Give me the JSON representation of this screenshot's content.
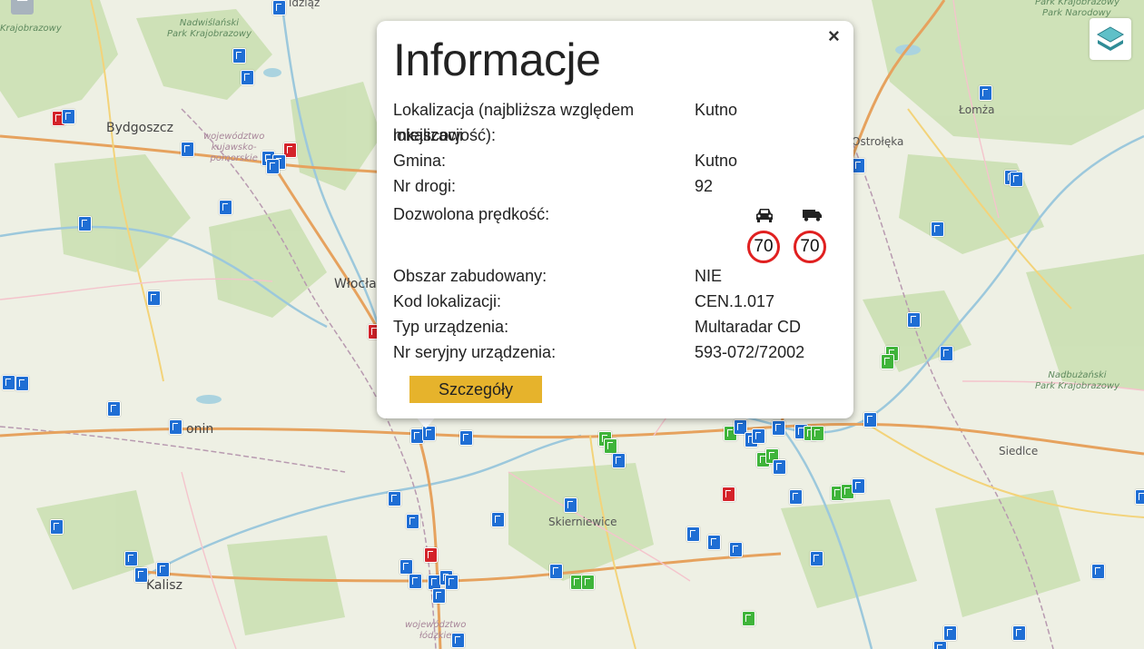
{
  "popup": {
    "title": "Informacje",
    "close": "×",
    "rows": [
      {
        "label": "Lokalizacja (najbliższa względem lokalizacji",
        "label2": "miejscowość):",
        "value": "Kutno"
      },
      {
        "label": "Gmina:",
        "value": "Kutno"
      },
      {
        "label": "Nr drogi:",
        "value": "92"
      },
      {
        "label": "Dozwolona prędkość:",
        "value": ""
      },
      {
        "label": "Obszar zabudowany:",
        "value": "NIE"
      },
      {
        "label": "Kod lokalizacji:",
        "value": "CEN.1.017"
      },
      {
        "label": "Typ urządzenia:",
        "value": "Multaradar CD"
      },
      {
        "label": "Nr seryjny urządzenia:",
        "value": "593-072/72002"
      }
    ],
    "speed_limits": {
      "car": "70",
      "truck": "70",
      "car_icon": "car-icon",
      "truck_icon": "truck-icon"
    },
    "details_button": "Szczegóły",
    "accent": "#e6b32c",
    "sign_color": "#e02020"
  },
  "controls": {
    "zoom_out": "−",
    "layers_icon": "layers-icon"
  },
  "map": {
    "places": {
      "bydgoszcz": "Bydgoszcz",
      "wloclawek": "Włocław",
      "konin": "onin",
      "kalisz": "Kalisz",
      "skierniewice": "Skierniewice",
      "ostroleka": "Ostrołęka",
      "lomza": "Łomża",
      "siedlce": "Siedlce",
      "idzig": "idziąż",
      "krajobrazowy_w": "Krajobrazowy",
      "park_kraj": "Park Krajobrazowy",
      "nadwislanski_1": "Nadwiślański",
      "nadwislanski_2": "Park Krajobrazowy",
      "woj_kuj_1": "województwo",
      "woj_kuj_2": "kujawsko-",
      "woj_kuj_3": "pomorskie",
      "park_narodowy": "Park Narodowy",
      "nadbuzanski_1": "Nadbużański",
      "nadbuzanski_2": "Park Krajobrazowy",
      "woj_lodz_1": "województwo",
      "woj_lodz_2": "łódzkie"
    },
    "marker_colors": {
      "blue": "#1f6ed4",
      "red": "#d4232a",
      "green": "#3fb43a"
    }
  }
}
